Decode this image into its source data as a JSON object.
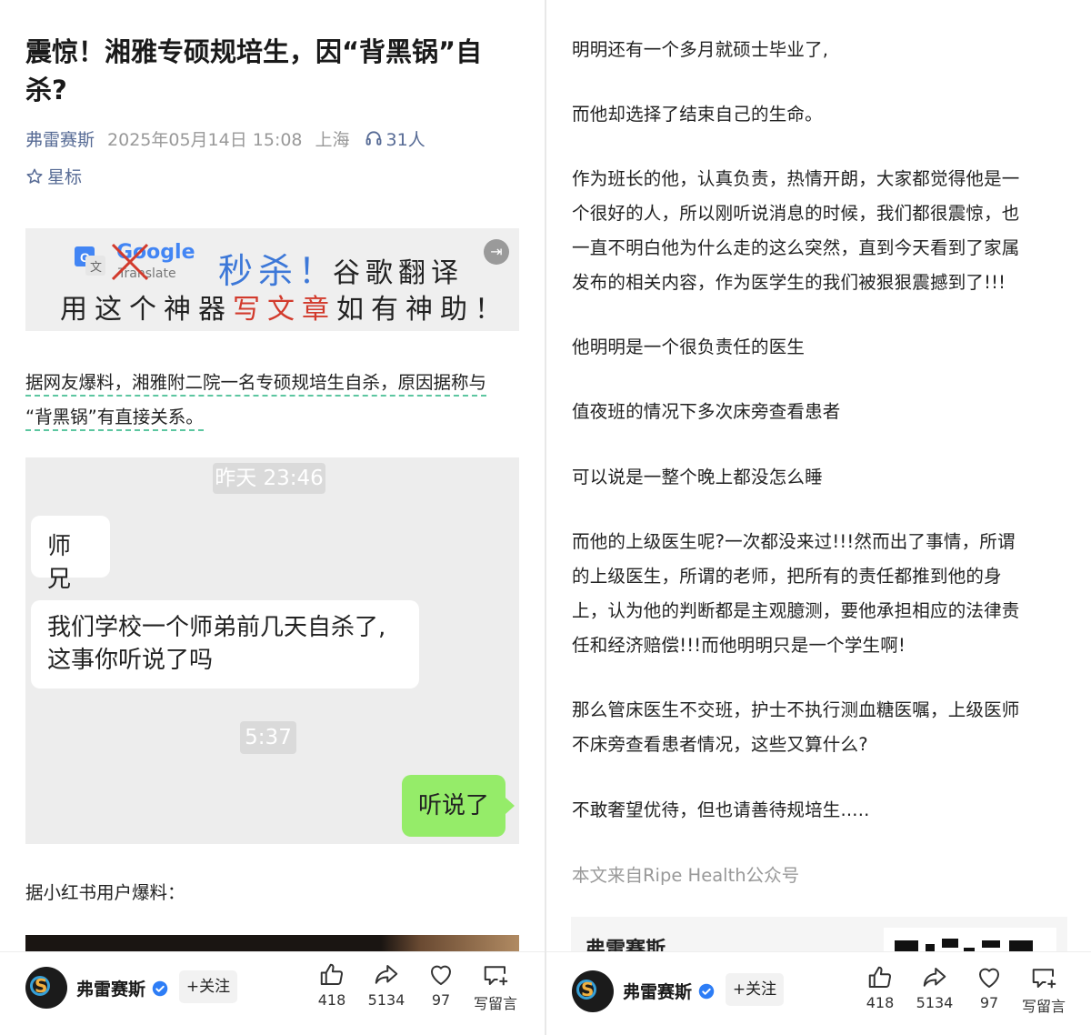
{
  "article": {
    "title": "震惊！湘雅专硕规培生，因“背黑锅”自杀?",
    "author": "弗雷赛斯",
    "datetime": "2025年05月14日 15:08",
    "location": "上海",
    "listeners": "31人",
    "star_label": "星标"
  },
  "banner": {
    "google_word": "Google",
    "google_sub": "Translate",
    "headline": "秒杀！",
    "headline_sub": "谷歌翻译",
    "line2_prefix": "用这个神器",
    "line2_red": "写文章",
    "line2_suffix": "如有神助！"
  },
  "left": {
    "intro_line1": "据网友爆料，湘雅附二院一名专硕规培生自杀，原因据称与",
    "intro_line2": "“背黑锅”有直接关系。",
    "xhs_label": "据小红书用户爆料："
  },
  "chat": {
    "time1": "昨天 23:46",
    "msg1": "师兄",
    "msg2_line1": "我们学校一个师弟前几天自杀了,",
    "msg2_line2": "这事你听说了吗",
    "time2": "5:37",
    "reply": "听说了"
  },
  "right": {
    "p1": "明明还有一个多月就硕士毕业了,",
    "p2": "而他却选择了结束自己的生命。",
    "p3_l1": "作为班长的他，认真负责，热情开朗，大家都觉得他是一",
    "p3_l2": "个很好的人，所以刚听说消息的时候，我们都很震惊，也",
    "p3_l3": "一直不明白他为什么走的这么突然，直到今天看到了家属",
    "p3_l4": "发布的相关内容，作为医学生的我们被狠狠震撼到了!!!",
    "p4": "他明明是一个很负责任的医生",
    "p5": "值夜班的情况下多次床旁查看患者",
    "p6": "可以说是一整个晚上都没怎么睡",
    "p7_l1": "而他的上级医生呢?一次都没来过!!!然而出了事情，所谓",
    "p7_l2": "的上级医生，所谓的老师，把所有的责任都推到他的身",
    "p7_l3": "上，认为他的判断都是主观臆测，要他承担相应的法律责",
    "p7_l4": "任和经济赔偿!!!而他明明只是一个学生啊!",
    "p8_l1": "那么管床医生不交班，护士不执行测血糖医嘱，上级医师",
    "p8_l2": "不床旁查看患者情况，这些又算什么?",
    "p9": "不敢奢望优待，但也请善待规培生.....",
    "source": "本文来自Ripe Health公众号",
    "card_name": "弗雷赛斯"
  },
  "footer": {
    "name": "弗雷赛斯",
    "follow": "+关注",
    "likes": "418",
    "shares": "5134",
    "favorites": "97",
    "comment_label": "写留言"
  },
  "colors": {
    "link_blue": "#576b95",
    "wechat_green": "#95ec69",
    "banner_red": "#d23a2c",
    "verified_blue": "#2d7df6"
  }
}
